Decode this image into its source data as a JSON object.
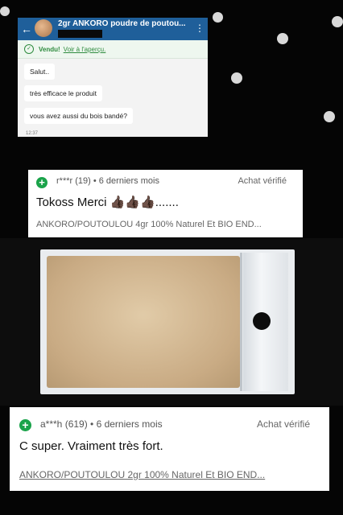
{
  "chat": {
    "title": "2gr ANKORO  poudre de poutou...",
    "sold_label": "Vendu!",
    "sold_link": "Voir à l'aperçu.",
    "messages": [
      "Salut..",
      "très efficace le produit",
      "vous avez aussi  du bois bandé?"
    ],
    "time": "12:37"
  },
  "reviews": [
    {
      "user": "r***r (19) • 6 derniers mois",
      "verified": "Achat vérifié",
      "text": "Tokoss Merci 👍🏿👍🏿👍🏿.......",
      "product": "ANKORO/POUTOULOU 4gr 100% Naturel Et BIO END..."
    },
    {
      "user": "a***h (619) • 6 derniers mois",
      "verified": "Achat vérifié",
      "text": "C super. Vraiment très fort.",
      "product": "ANKORO/POUTOULOU 2gr 100% Naturel Et BIO END..."
    }
  ],
  "icons": {
    "back": "back-arrow-icon",
    "menu": "kebab-menu-icon",
    "sold": "check-circle-icon",
    "positive": "plus-circle-icon"
  },
  "colors": {
    "header": "#1f5f9a",
    "positive": "#1aa34a",
    "background": "#050505"
  }
}
